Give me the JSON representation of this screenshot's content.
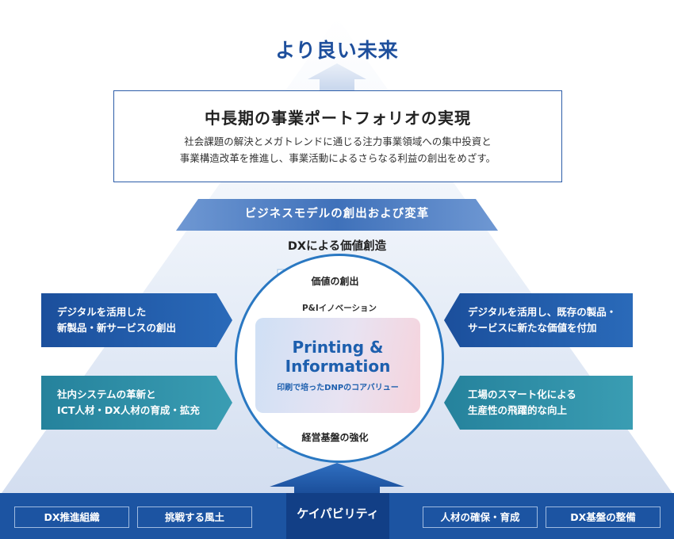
{
  "title": "より良い未来",
  "portfolio": {
    "title": "中長期の事業ポートフォリオの実現",
    "desc_line1": "社会課題の解決とメガトレンドに通じる注力事業領域への集中投資と",
    "desc_line2": "事業構造改革を推進し、事業活動によるさらなる利益の創出をめざす。"
  },
  "business_model": "ビジネスモデルの創出および変革",
  "dx_value": "DXによる価値創造",
  "center": {
    "top_tag": "価値の創出",
    "innovation_label": "P&Iイノベーション",
    "core_line1": "Printing &",
    "core_line2": "Information",
    "core_sub": "印刷で培ったDNPのコアバリュー",
    "bottom_tag": "経営基盤の強化"
  },
  "left_items": [
    {
      "line1": "デジタルを活用した",
      "line2": "新製品・新サービスの創出"
    },
    {
      "line1": "社内システムの革新と",
      "line2": "ICT人材・DX人材の育成・拡充"
    }
  ],
  "right_items": [
    {
      "line1": "デジタルを活用し、既存の製品・",
      "line2": "サービスに新たな価値を付加"
    },
    {
      "line1": "工場のスマート化による",
      "line2": "生産性の飛躍的な向上"
    }
  ],
  "bottom": {
    "capability": "ケイパビリティ",
    "items": [
      "DX推進組織",
      "挑戦する風土",
      "人材の確保・育成",
      "DX基盤の整備"
    ]
  },
  "colors": {
    "title_blue": "#1e4f9c",
    "dark_blue": "#1c54a2",
    "circle_blue": "#2a78c2",
    "teal": "#2f8fa8",
    "band_blue": "#4f7fc4"
  }
}
